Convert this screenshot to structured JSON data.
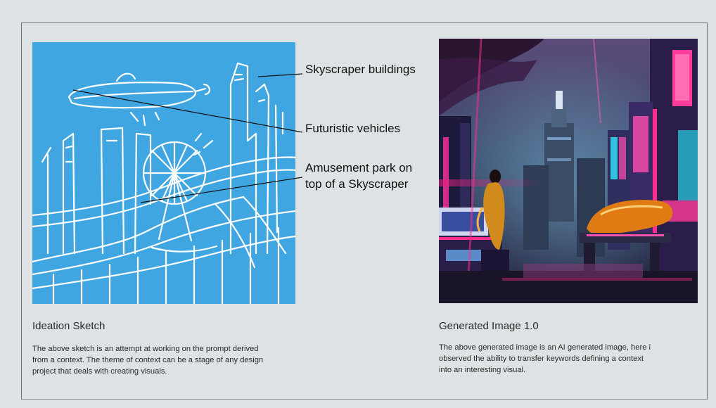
{
  "callouts": {
    "skyscraper": "Skyscraper buildings",
    "vehicles": "Futuristic vehicles",
    "park_line1": "Amusement park on",
    "park_line2": "top of a Skyscraper"
  },
  "left": {
    "title": "Ideation Sketch",
    "text_line1": "The above sketch is an attempt at working on the prompt derived",
    "text_line2": "from a context. The theme of context can be a stage of any design",
    "text_line3": "project that deals with creating visuals."
  },
  "right": {
    "title": "Generated Image 1.0",
    "text_line1": "The above generated image is an AI generated image, here i",
    "text_line2": "observed the ability to transfer keywords defining a context",
    "text_line3": "into an interesting visual."
  },
  "colors": {
    "background": "#dde3e4",
    "sketch_blue": "#3fa6e2"
  }
}
